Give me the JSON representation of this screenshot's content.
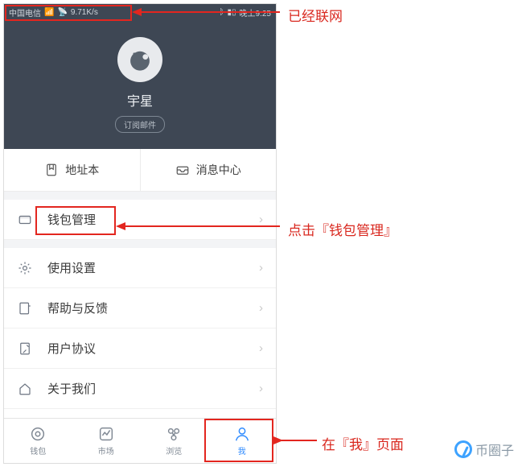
{
  "status_bar": {
    "carrier": "中国电信",
    "speed": "9.71K/s",
    "time": "晚上9:25"
  },
  "profile": {
    "username": "宇星",
    "sub_label": "订阅邮件"
  },
  "quick": {
    "address_book": "地址本",
    "message_center": "消息中心"
  },
  "menu": {
    "wallet_manage": "钱包管理",
    "settings": "使用设置",
    "help": "帮助与反馈",
    "agreement": "用户协议",
    "about": "关于我们"
  },
  "tabs": {
    "wallet": "钱包",
    "market": "市场",
    "browse": "浏览",
    "me": "我"
  },
  "annotations": {
    "networked": "已经联网",
    "click_wallet": "点击『钱包管理』",
    "on_me_page": "在『我』页面"
  },
  "watermark": "币圈子"
}
